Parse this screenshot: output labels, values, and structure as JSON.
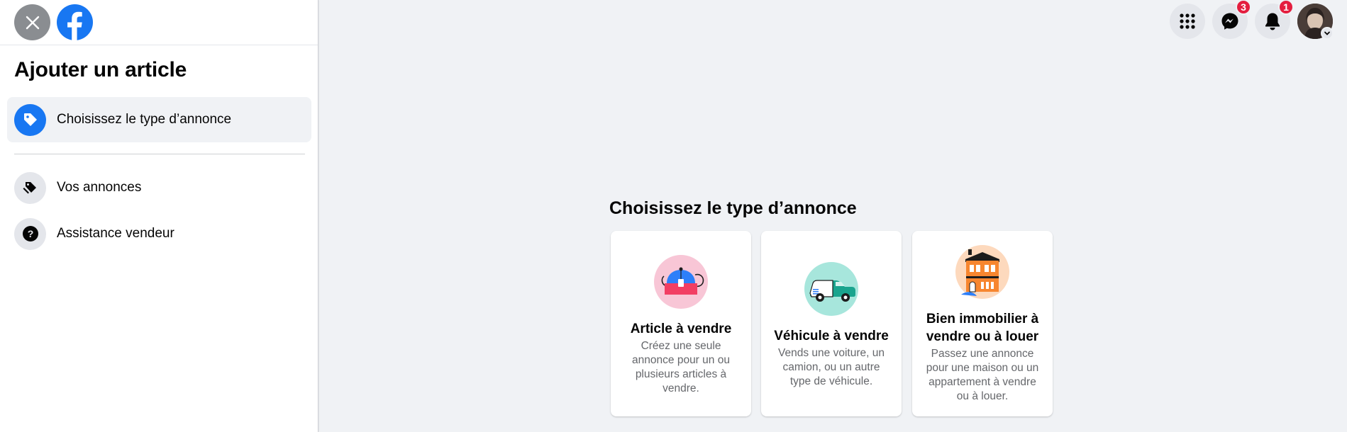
{
  "sidebar": {
    "title": "Ajouter un article",
    "items": [
      {
        "label": "Choisissez le type d’annonce",
        "icon": "tag-icon",
        "active": true
      },
      {
        "label": "Vos annonces",
        "icon": "tags-icon",
        "active": false
      },
      {
        "label": "Assistance vendeur",
        "icon": "help-icon",
        "active": false
      }
    ]
  },
  "header": {
    "messenger_badge": "3",
    "notifications_badge": "1"
  },
  "main": {
    "title": "Choisissez le type d’annonce",
    "cards": [
      {
        "title": "Article à vendre",
        "description": "Créez une seule annonce pour un ou plusieurs articles à vendre.",
        "icon": "teapot-illustration-icon"
      },
      {
        "title": "Véhicule à vendre",
        "description": "Vends une voiture, un camion, ou un autre type de véhicule.",
        "icon": "car-illustration-icon"
      },
      {
        "title": "Bien immobilier à vendre ou à louer",
        "description": "Passez une annonce pour une maison ou un appartement à vendre ou à louer.",
        "icon": "house-illustration-icon"
      }
    ]
  },
  "colors": {
    "brand": "#1877f2",
    "badge": "#e41e3f",
    "background": "#f0f2f5"
  }
}
